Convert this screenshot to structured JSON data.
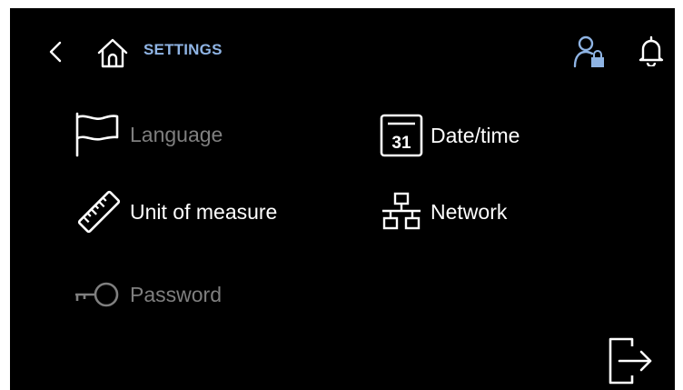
{
  "header": {
    "title": "SETTINGS",
    "back_icon": "chevron-left-icon",
    "home_icon": "home-icon",
    "user_icon": "user-lock-icon",
    "bell_icon": "bell-icon"
  },
  "menu": [
    {
      "label": "Language",
      "icon": "flag-icon",
      "enabled": false
    },
    {
      "label": "Date/time",
      "icon": "calendar-icon",
      "calendar_day": "31",
      "enabled": true
    },
    {
      "label": "Unit of measure",
      "icon": "ruler-icon",
      "enabled": true
    },
    {
      "label": "Network",
      "icon": "network-icon",
      "enabled": true
    },
    {
      "label": "Password",
      "icon": "key-icon",
      "enabled": false
    }
  ],
  "footer": {
    "logout_icon": "logout-icon"
  },
  "colors": {
    "background": "#000000",
    "title_accent": "#8fb4e4",
    "enabled_text": "#ffffff",
    "disabled_text": "#7f7f7f"
  }
}
